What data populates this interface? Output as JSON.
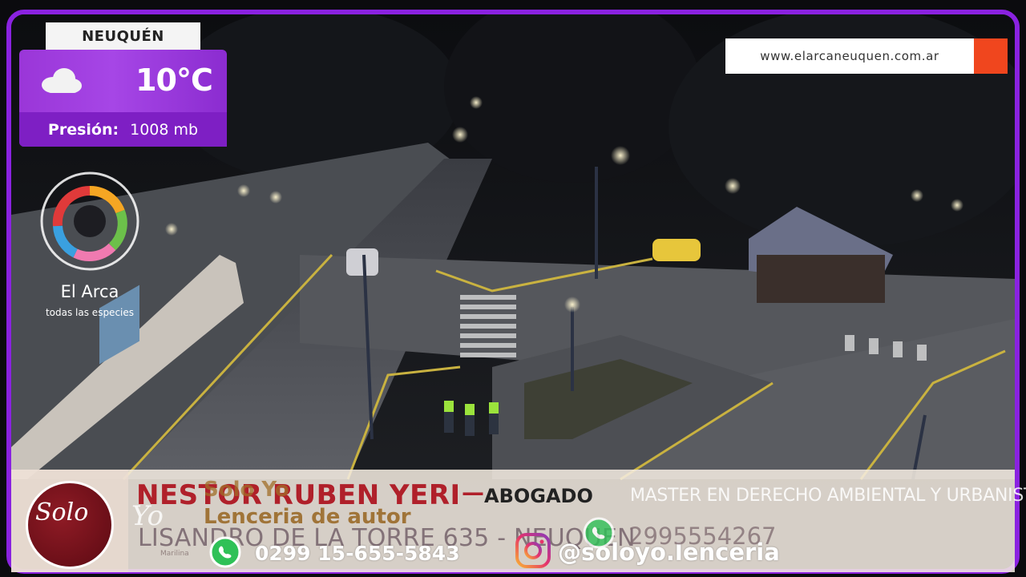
{
  "location": {
    "city": "NEUQUÉN"
  },
  "weather": {
    "icon": "cloud-icon",
    "temperature": "10°C",
    "pressure_label": "Presión:",
    "pressure_value": "1008 mb"
  },
  "website": {
    "url": "www.elarcaneuquen.com.ar",
    "accent_color": "#f0461e"
  },
  "sponsor_logo": {
    "name": "El Arca",
    "tagline": "todas las especies"
  },
  "ticker": {
    "lawyer_name": "NESTOR RUBEN YERI",
    "lawyer_dash": "—",
    "lawyer_title": "ABOGADO",
    "lawyer_master": "MASTER EN DERECHO AMBIENTAL Y URBANISTICO",
    "lawyer_address": "LISANDRO DE LA TORRE 635 - NEUQUEN",
    "lawyer_phone": "2995554267",
    "store_brand": "Solo Yo",
    "store_tagline": "Lenceria de autor",
    "store_logo_text": "Solo",
    "store_logo_text2": "Yo",
    "store_signature": "Marilina",
    "store_phone": "0299 15-655-5843",
    "store_instagram": "@soloyo.lenceria"
  },
  "colors": {
    "frame": "#8a22e0",
    "weather_bg": "#a646e6",
    "lawyer_red": "#b0202a"
  }
}
